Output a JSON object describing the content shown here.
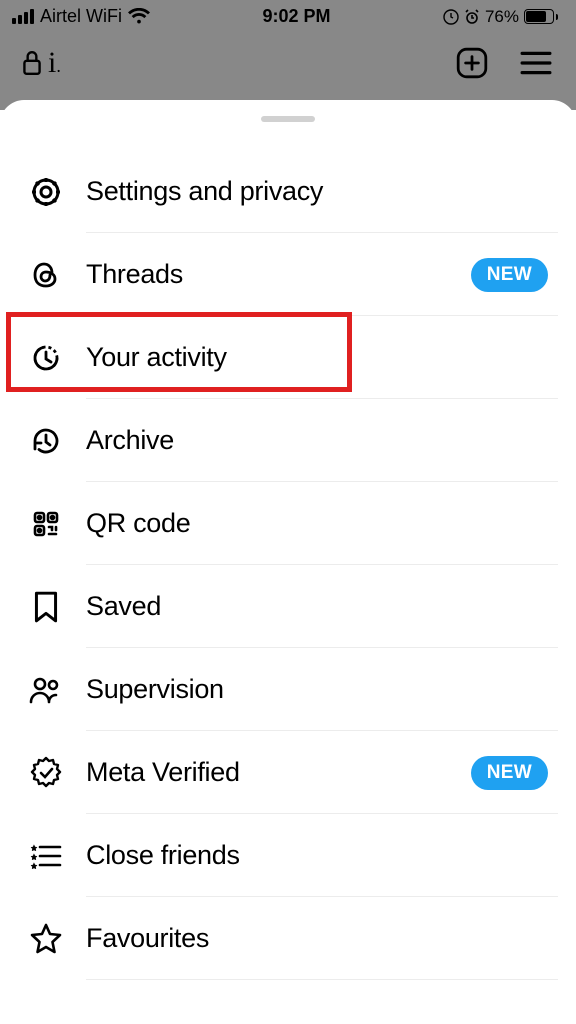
{
  "status": {
    "carrier": "Airtel WiFi",
    "time": "9:02 PM",
    "battery_pct": "76%"
  },
  "menu": {
    "items": [
      {
        "label": "Settings and privacy",
        "icon": "settings-icon",
        "badge": null
      },
      {
        "label": "Threads",
        "icon": "threads-icon",
        "badge": "NEW"
      },
      {
        "label": "Your activity",
        "icon": "activity-icon",
        "badge": null
      },
      {
        "label": "Archive",
        "icon": "archive-icon",
        "badge": null
      },
      {
        "label": "QR code",
        "icon": "qr-icon",
        "badge": null
      },
      {
        "label": "Saved",
        "icon": "saved-icon",
        "badge": null
      },
      {
        "label": "Supervision",
        "icon": "supervision-icon",
        "badge": null
      },
      {
        "label": "Meta Verified",
        "icon": "verified-icon",
        "badge": "NEW"
      },
      {
        "label": "Close friends",
        "icon": "close-friends-icon",
        "badge": null
      },
      {
        "label": "Favourites",
        "icon": "favourites-icon",
        "badge": null
      }
    ]
  },
  "highlight": {
    "index": 2
  }
}
